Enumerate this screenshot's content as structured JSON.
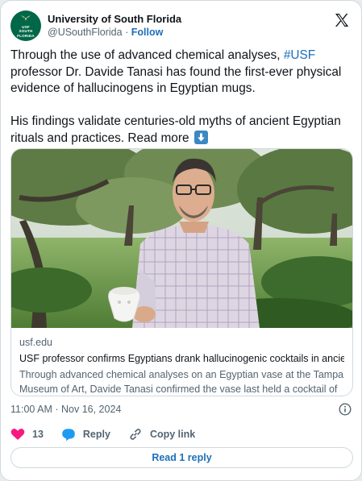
{
  "account": {
    "name": "University of South Florida",
    "handle": "@USouthFlorida",
    "separator": "·",
    "follow_label": "Follow",
    "avatar_text": [
      "USF",
      "SOUTH",
      "FLORIDA"
    ]
  },
  "tweet": {
    "text_part1": "Through the use of advanced chemical analyses, ",
    "hashtag": "#USF",
    "text_part2": " professor Dr. Davide Tanasi has found the first-ever physical evidence of hallucinogens in Egyptian mugs.",
    "text_para2": "His findings validate centuries-old myths of ancient Egyptian rituals and practices. Read more ",
    "emoji": "down-arrow-emoji"
  },
  "link_card": {
    "domain": "usf.edu",
    "title": "USF professor confirms Egyptians drank hallucinogenic cocktails in ancien...",
    "description": "Through advanced chemical analyses on an Egyptian vase at the Tampa Museum of Art, Davide Tanasi confirmed the vase last held a cocktail of ..."
  },
  "timestamp": "11:00 AM · Nov 16, 2024",
  "actions": {
    "like_count": "13",
    "reply_label": "Reply",
    "copy_label": "Copy link"
  },
  "read_replies_label": "Read 1 reply",
  "colors": {
    "link": "#1d6fb8",
    "heart": "#f91880",
    "usf_green": "#006747",
    "secondary_text": "#536471"
  },
  "icons": [
    "x-logo-icon",
    "info-icon",
    "heart-icon",
    "reply-bubble-icon",
    "link-icon",
    "down-arrow-emoji"
  ]
}
